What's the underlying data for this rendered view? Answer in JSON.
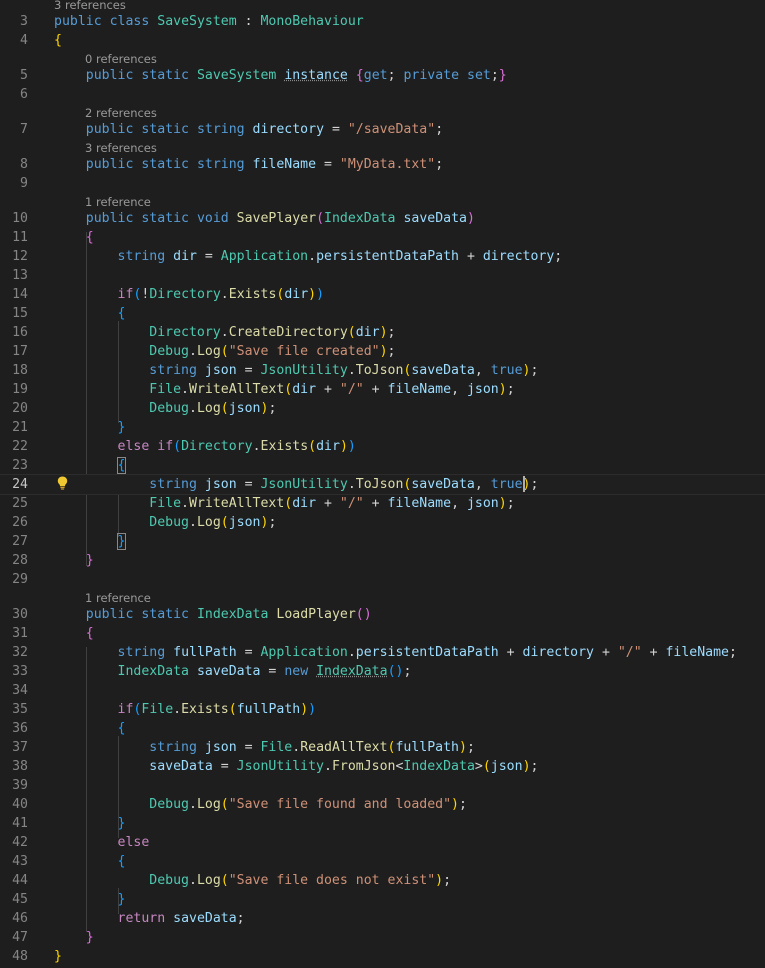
{
  "codelens": {
    "l3": "3 references",
    "l5": "0 references",
    "l7": "2 references",
    "l8": "3 references",
    "l10": "1 reference",
    "l30": "1 reference"
  },
  "line_numbers": [
    "3",
    "4",
    "5",
    "6",
    "7",
    "8",
    "9",
    "10",
    "11",
    "12",
    "13",
    "14",
    "15",
    "16",
    "17",
    "18",
    "19",
    "20",
    "21",
    "22",
    "23",
    "24",
    "25",
    "26",
    "27",
    "28",
    "29",
    "30",
    "31",
    "32",
    "33",
    "34",
    "35",
    "36",
    "37",
    "38",
    "39",
    "40",
    "41",
    "42",
    "43",
    "44",
    "45",
    "46",
    "47",
    "48"
  ],
  "editor": {
    "current_line": "24",
    "lightbulb_icon": "lightbulb-icon"
  },
  "colors": {
    "background": "#1e1e1e",
    "keyword": "#569cd6",
    "control": "#c586c0",
    "type": "#4ec9b0",
    "function": "#dcdcaa",
    "variable": "#9cdcfe",
    "string": "#ce9178",
    "bracket_gold": "#ffd700",
    "bracket_pink": "#da70d6",
    "bracket_blue": "#179fff"
  },
  "code_lines": [
    [
      [
        "kw",
        "public"
      ],
      [
        "op",
        " "
      ],
      [
        "kw",
        "class"
      ],
      [
        "op",
        " "
      ],
      [
        "type",
        "SaveSystem"
      ],
      [
        "op",
        " : "
      ],
      [
        "type",
        "MonoBehaviour"
      ]
    ],
    [
      [
        "b1",
        "{"
      ]
    ],
    [
      [
        "op",
        "    "
      ],
      [
        "kw",
        "public"
      ],
      [
        "op",
        " "
      ],
      [
        "kw",
        "static"
      ],
      [
        "op",
        " "
      ],
      [
        "type",
        "SaveSystem"
      ],
      [
        "op",
        " "
      ],
      [
        "var dotted",
        "instance"
      ],
      [
        "op",
        " "
      ],
      [
        "b2",
        "{"
      ],
      [
        "kw",
        "get"
      ],
      [
        "op",
        "; "
      ],
      [
        "kw",
        "private"
      ],
      [
        "op",
        " "
      ],
      [
        "kw",
        "set"
      ],
      [
        "op",
        ";"
      ],
      [
        "b2",
        "}"
      ]
    ],
    [],
    [
      [
        "op",
        "    "
      ],
      [
        "kw",
        "public"
      ],
      [
        "op",
        " "
      ],
      [
        "kw",
        "static"
      ],
      [
        "op",
        " "
      ],
      [
        "kw",
        "string"
      ],
      [
        "op",
        " "
      ],
      [
        "var",
        "directory"
      ],
      [
        "op",
        " = "
      ],
      [
        "str",
        "\"/saveData\""
      ],
      [
        "op",
        ";"
      ]
    ],
    [
      [
        "op",
        "    "
      ],
      [
        "kw",
        "public"
      ],
      [
        "op",
        " "
      ],
      [
        "kw",
        "static"
      ],
      [
        "op",
        " "
      ],
      [
        "kw",
        "string"
      ],
      [
        "op",
        " "
      ],
      [
        "var",
        "fileName"
      ],
      [
        "op",
        " = "
      ],
      [
        "str",
        "\"MyData.txt\""
      ],
      [
        "op",
        ";"
      ]
    ],
    [],
    [
      [
        "op",
        "    "
      ],
      [
        "kw",
        "public"
      ],
      [
        "op",
        " "
      ],
      [
        "kw",
        "static"
      ],
      [
        "op",
        " "
      ],
      [
        "kw",
        "void"
      ],
      [
        "op",
        " "
      ],
      [
        "fn",
        "SavePlayer"
      ],
      [
        "b2",
        "("
      ],
      [
        "type",
        "IndexData"
      ],
      [
        "op",
        " "
      ],
      [
        "var",
        "saveData"
      ],
      [
        "b2",
        ")"
      ]
    ],
    [
      [
        "op",
        "    "
      ],
      [
        "b2",
        "{"
      ]
    ],
    [
      [
        "op",
        "        "
      ],
      [
        "kw",
        "string"
      ],
      [
        "op",
        " "
      ],
      [
        "var",
        "dir"
      ],
      [
        "op",
        " = "
      ],
      [
        "type",
        "Application"
      ],
      [
        "op",
        "."
      ],
      [
        "var",
        "persistentDataPath"
      ],
      [
        "op",
        " + "
      ],
      [
        "var",
        "directory"
      ],
      [
        "op",
        ";"
      ]
    ],
    [],
    [
      [
        "op",
        "        "
      ],
      [
        "ctl",
        "if"
      ],
      [
        "b3",
        "("
      ],
      [
        "op",
        "!"
      ],
      [
        "type",
        "Directory"
      ],
      [
        "op",
        "."
      ],
      [
        "fn",
        "Exists"
      ],
      [
        "b1",
        "("
      ],
      [
        "var",
        "dir"
      ],
      [
        "b1",
        ")"
      ],
      [
        "b3",
        ")"
      ]
    ],
    [
      [
        "op",
        "        "
      ],
      [
        "b3",
        "{"
      ]
    ],
    [
      [
        "op",
        "            "
      ],
      [
        "type",
        "Directory"
      ],
      [
        "op",
        "."
      ],
      [
        "fn",
        "CreateDirectory"
      ],
      [
        "b1",
        "("
      ],
      [
        "var",
        "dir"
      ],
      [
        "b1",
        ")"
      ],
      [
        "op",
        ";"
      ]
    ],
    [
      [
        "op",
        "            "
      ],
      [
        "type",
        "Debug"
      ],
      [
        "op",
        "."
      ],
      [
        "fn",
        "Log"
      ],
      [
        "b1",
        "("
      ],
      [
        "str",
        "\"Save file created\""
      ],
      [
        "b1",
        ")"
      ],
      [
        "op",
        ";"
      ]
    ],
    [
      [
        "op",
        "            "
      ],
      [
        "kw",
        "string"
      ],
      [
        "op",
        " "
      ],
      [
        "var",
        "json"
      ],
      [
        "op",
        " = "
      ],
      [
        "type",
        "JsonUtility"
      ],
      [
        "op",
        "."
      ],
      [
        "fn",
        "ToJson"
      ],
      [
        "b1",
        "("
      ],
      [
        "var",
        "saveData"
      ],
      [
        "op",
        ", "
      ],
      [
        "kw",
        "true"
      ],
      [
        "b1",
        ")"
      ],
      [
        "op",
        ";"
      ]
    ],
    [
      [
        "op",
        "            "
      ],
      [
        "type",
        "File"
      ],
      [
        "op",
        "."
      ],
      [
        "fn",
        "WriteAllText"
      ],
      [
        "b1",
        "("
      ],
      [
        "var",
        "dir"
      ],
      [
        "op",
        " + "
      ],
      [
        "str",
        "\"/\""
      ],
      [
        "op",
        " + "
      ],
      [
        "var",
        "fileName"
      ],
      [
        "op",
        ", "
      ],
      [
        "var",
        "json"
      ],
      [
        "b1",
        ")"
      ],
      [
        "op",
        ";"
      ]
    ],
    [
      [
        "op",
        "            "
      ],
      [
        "type",
        "Debug"
      ],
      [
        "op",
        "."
      ],
      [
        "fn",
        "Log"
      ],
      [
        "b1",
        "("
      ],
      [
        "var",
        "json"
      ],
      [
        "b1",
        ")"
      ],
      [
        "op",
        ";"
      ]
    ],
    [
      [
        "op",
        "        "
      ],
      [
        "b3",
        "}"
      ]
    ],
    [
      [
        "op",
        "        "
      ],
      [
        "ctl",
        "else"
      ],
      [
        "op",
        " "
      ],
      [
        "ctl",
        "if"
      ],
      [
        "b3",
        "("
      ],
      [
        "type",
        "Directory"
      ],
      [
        "op",
        "."
      ],
      [
        "fn",
        "Exists"
      ],
      [
        "b1",
        "("
      ],
      [
        "var",
        "dir"
      ],
      [
        "b1",
        ")"
      ],
      [
        "b3",
        ")"
      ]
    ],
    [
      [
        "op",
        "        "
      ],
      [
        "b3 boxed",
        "{"
      ]
    ],
    [
      [
        "op",
        "            "
      ],
      [
        "kw",
        "string"
      ],
      [
        "op",
        " "
      ],
      [
        "var",
        "json"
      ],
      [
        "op",
        " = "
      ],
      [
        "type",
        "JsonUtility"
      ],
      [
        "op",
        "."
      ],
      [
        "fn",
        "ToJson"
      ],
      [
        "b1",
        "("
      ],
      [
        "var",
        "saveData"
      ],
      [
        "op",
        ", "
      ],
      [
        "kw",
        "true"
      ],
      [
        "b1",
        ")"
      ],
      [
        "op",
        ";"
      ]
    ],
    [
      [
        "op",
        "            "
      ],
      [
        "type",
        "File"
      ],
      [
        "op",
        "."
      ],
      [
        "fn",
        "WriteAllText"
      ],
      [
        "b1",
        "("
      ],
      [
        "var",
        "dir"
      ],
      [
        "op",
        " + "
      ],
      [
        "str",
        "\"/\""
      ],
      [
        "op",
        " + "
      ],
      [
        "var",
        "fileName"
      ],
      [
        "op",
        ", "
      ],
      [
        "var",
        "json"
      ],
      [
        "b1",
        ")"
      ],
      [
        "op",
        ";"
      ]
    ],
    [
      [
        "op",
        "            "
      ],
      [
        "type",
        "Debug"
      ],
      [
        "op",
        "."
      ],
      [
        "fn",
        "Log"
      ],
      [
        "b1",
        "("
      ],
      [
        "var",
        "json"
      ],
      [
        "b1",
        ")"
      ],
      [
        "op",
        ";"
      ]
    ],
    [
      [
        "op",
        "        "
      ],
      [
        "b3 boxed",
        "}"
      ]
    ],
    [
      [
        "op",
        "    "
      ],
      [
        "b2",
        "}"
      ]
    ],
    [],
    [
      [
        "op",
        "    "
      ],
      [
        "kw",
        "public"
      ],
      [
        "op",
        " "
      ],
      [
        "kw",
        "static"
      ],
      [
        "op",
        " "
      ],
      [
        "type",
        "IndexData"
      ],
      [
        "op",
        " "
      ],
      [
        "fn",
        "LoadPlayer"
      ],
      [
        "b2",
        "("
      ],
      [
        "b2",
        ")"
      ]
    ],
    [
      [
        "op",
        "    "
      ],
      [
        "b2",
        "{"
      ]
    ],
    [
      [
        "op",
        "        "
      ],
      [
        "kw",
        "string"
      ],
      [
        "op",
        " "
      ],
      [
        "var",
        "fullPath"
      ],
      [
        "op",
        " = "
      ],
      [
        "type",
        "Application"
      ],
      [
        "op",
        "."
      ],
      [
        "var",
        "persistentDataPath"
      ],
      [
        "op",
        " + "
      ],
      [
        "var",
        "directory"
      ],
      [
        "op",
        " + "
      ],
      [
        "str",
        "\"/\""
      ],
      [
        "op",
        " + "
      ],
      [
        "var",
        "fileName"
      ],
      [
        "op",
        ";"
      ]
    ],
    [
      [
        "op",
        "        "
      ],
      [
        "type",
        "IndexData"
      ],
      [
        "op",
        " "
      ],
      [
        "var",
        "saveData"
      ],
      [
        "op",
        " = "
      ],
      [
        "kw",
        "new"
      ],
      [
        "op",
        " "
      ],
      [
        "type dotted",
        "IndexData"
      ],
      [
        "b3",
        "("
      ],
      [
        "b3",
        ")"
      ],
      [
        "op",
        ";"
      ]
    ],
    [],
    [
      [
        "op",
        "        "
      ],
      [
        "ctl",
        "if"
      ],
      [
        "b3",
        "("
      ],
      [
        "type",
        "File"
      ],
      [
        "op",
        "."
      ],
      [
        "fn",
        "Exists"
      ],
      [
        "b1",
        "("
      ],
      [
        "var",
        "fullPath"
      ],
      [
        "b1",
        ")"
      ],
      [
        "b3",
        ")"
      ]
    ],
    [
      [
        "op",
        "        "
      ],
      [
        "b3",
        "{"
      ]
    ],
    [
      [
        "op",
        "            "
      ],
      [
        "kw",
        "string"
      ],
      [
        "op",
        " "
      ],
      [
        "var",
        "json"
      ],
      [
        "op",
        " = "
      ],
      [
        "type",
        "File"
      ],
      [
        "op",
        "."
      ],
      [
        "fn",
        "ReadAllText"
      ],
      [
        "b1",
        "("
      ],
      [
        "var",
        "fullPath"
      ],
      [
        "b1",
        ")"
      ],
      [
        "op",
        ";"
      ]
    ],
    [
      [
        "op",
        "            "
      ],
      [
        "var",
        "saveData"
      ],
      [
        "op",
        " = "
      ],
      [
        "type",
        "JsonUtility"
      ],
      [
        "op",
        "."
      ],
      [
        "fn",
        "FromJson"
      ],
      [
        "op",
        "<"
      ],
      [
        "type",
        "IndexData"
      ],
      [
        "op",
        ">"
      ],
      [
        "b1",
        "("
      ],
      [
        "var",
        "json"
      ],
      [
        "b1",
        ")"
      ],
      [
        "op",
        ";"
      ]
    ],
    [],
    [
      [
        "op",
        "            "
      ],
      [
        "type",
        "Debug"
      ],
      [
        "op",
        "."
      ],
      [
        "fn",
        "Log"
      ],
      [
        "b1",
        "("
      ],
      [
        "str",
        "\"Save file found and loaded\""
      ],
      [
        "b1",
        ")"
      ],
      [
        "op",
        ";"
      ]
    ],
    [
      [
        "op",
        "        "
      ],
      [
        "b3",
        "}"
      ]
    ],
    [
      [
        "op",
        "        "
      ],
      [
        "ctl",
        "else"
      ]
    ],
    [
      [
        "op",
        "        "
      ],
      [
        "b3",
        "{"
      ]
    ],
    [
      [
        "op",
        "            "
      ],
      [
        "type",
        "Debug"
      ],
      [
        "op",
        "."
      ],
      [
        "fn",
        "Log"
      ],
      [
        "b1",
        "("
      ],
      [
        "str",
        "\"Save file does not exist\""
      ],
      [
        "b1",
        ")"
      ],
      [
        "op",
        ";"
      ]
    ],
    [
      [
        "op",
        "        "
      ],
      [
        "b3",
        "}"
      ]
    ],
    [
      [
        "op",
        "        "
      ],
      [
        "ctl",
        "return"
      ],
      [
        "op",
        " "
      ],
      [
        "var",
        "saveData"
      ],
      [
        "op",
        ";"
      ]
    ],
    [
      [
        "op",
        "    "
      ],
      [
        "b2",
        "}"
      ]
    ],
    [
      [
        "b1",
        "}"
      ]
    ]
  ]
}
